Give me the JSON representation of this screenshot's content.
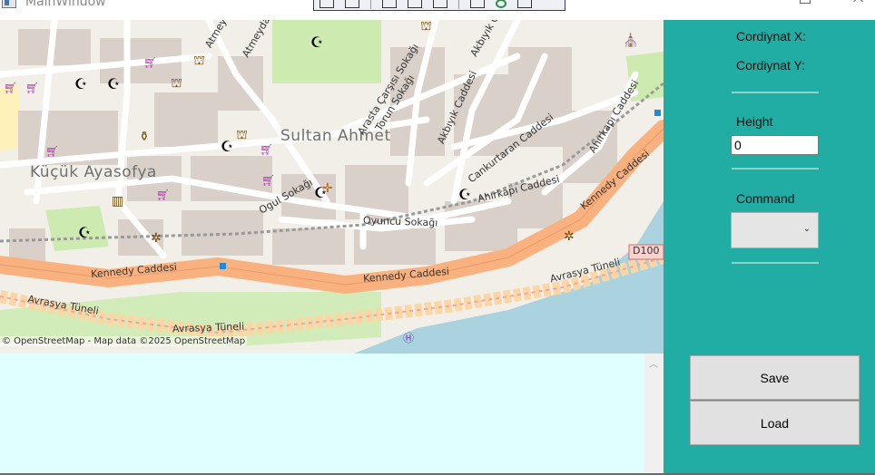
{
  "window": {
    "title": "MainWindow",
    "controls": [
      "minimize",
      "maximize",
      "close"
    ]
  },
  "map": {
    "districts": [
      "Sultan Ahmet",
      "Küçük Ayasofya"
    ],
    "streets": [
      "Kennedy Caddesi",
      "Kennedy Caddesi",
      "Kennedy Caddesi",
      "Avrasya Tüneli",
      "Avrasya Tüneli",
      "Avrasya Tüneli",
      "Arasta Çarşısı Sokağı",
      "Torun Sokağı",
      "Akbıyık Caddesi",
      "Akbıyık Cad",
      "Cankurtaran Caddesi",
      "Ahırkapı Caddesi",
      "Ahırkapı Caddesi",
      "Oyuncu Sokağı",
      "Ogul Sokağı",
      "Atmeydanı",
      "Atmey"
    ],
    "route_shield": "D100",
    "attribution": "© OpenStreetMap - Map data ©2025 OpenStreetMap"
  },
  "panel": {
    "coord_x_label": "Cordiynat X:",
    "coord_y_label": "Cordiynat Y:",
    "height_label": "Height",
    "height_value": "0",
    "command_label": "Command",
    "command_value": ""
  },
  "actions": {
    "save_label": "Save",
    "load_label": "Load"
  },
  "colors": {
    "panel": "#21ada3",
    "bottom_area": "#e0ffff",
    "water": "#aad3df",
    "trunk_road": "#f9b27f",
    "tunnel_road": "#fcd6a4"
  }
}
